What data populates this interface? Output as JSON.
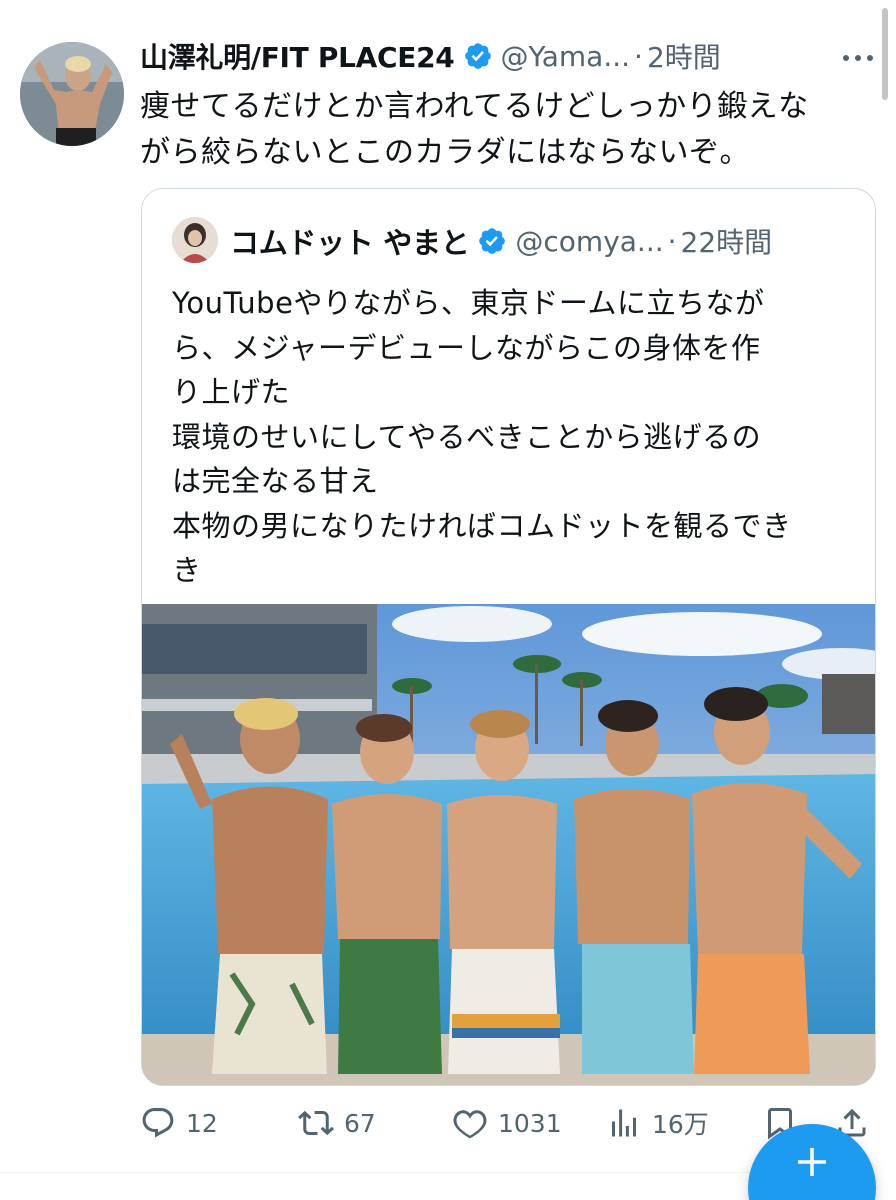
{
  "tweet": {
    "author_name": "山澤礼明/FIT PLACE24",
    "handle": "@Yama...",
    "separator": "·",
    "time": "2時間",
    "text_line1": "痩せてるだけとか言われてるけどしっかり鍛えな",
    "text_line2": "がら絞らないとこのカラダにはならないぞ。"
  },
  "quote": {
    "author_name": "コムドット やまと",
    "handle": "@comya...",
    "separator": "·",
    "time": "22時間",
    "lines": [
      "YouTubeやりながら、東京ドームに立ちなが",
      "ら、メジャーデビューしながらこの身体を作",
      "り上げた",
      "環境のせいにしてやるべきことから逃げるの",
      "は完全なる甘え",
      "本物の男になりたければコムドットを観るでき",
      "き"
    ]
  },
  "actions": {
    "replies": "12",
    "retweets": "67",
    "likes": "1031",
    "views": "16万"
  },
  "colors": {
    "accent": "#1d9bf0",
    "secondary_text": "#536471",
    "border": "#cfd9de"
  },
  "icons": [
    "more-icon",
    "verified-badge-icon",
    "reply-icon",
    "retweet-icon",
    "like-icon",
    "views-icon",
    "bookmark-icon",
    "share-icon",
    "compose-icon"
  ]
}
